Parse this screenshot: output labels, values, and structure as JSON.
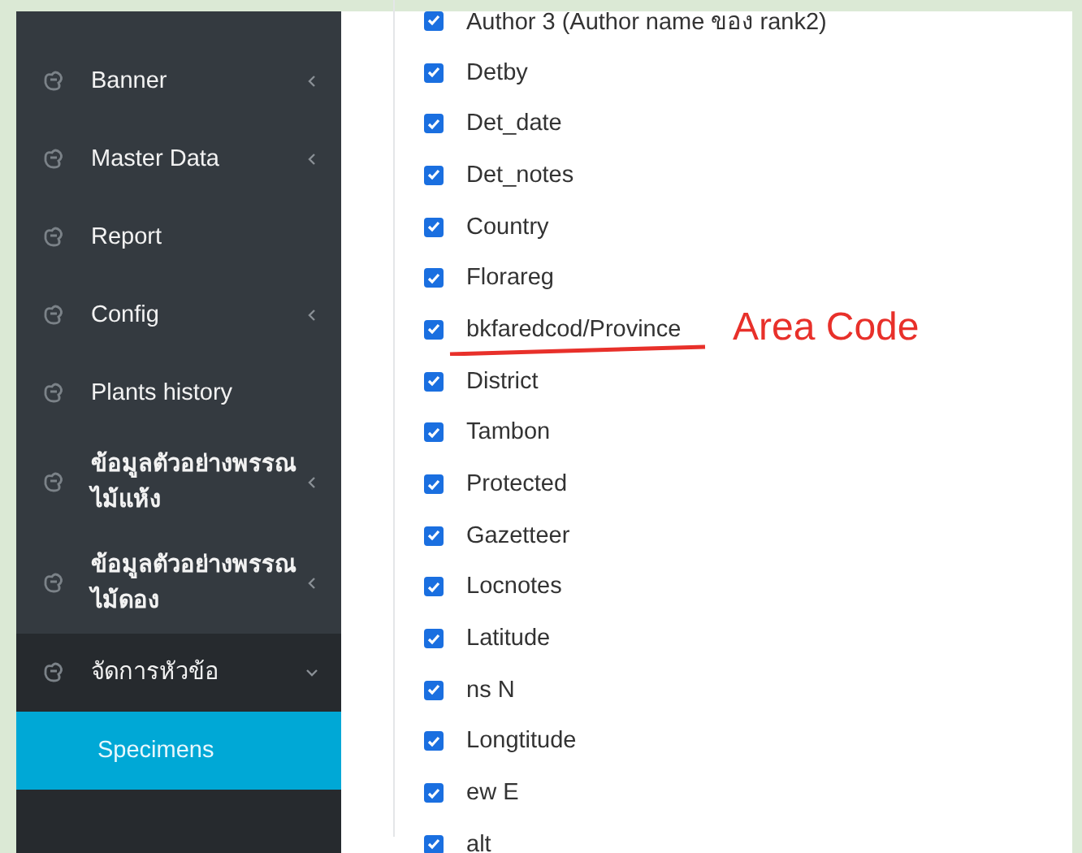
{
  "sidebar": {
    "items": [
      {
        "label": "Banner",
        "has_submenu": true,
        "expanded": false
      },
      {
        "label": "Master Data",
        "has_submenu": true,
        "expanded": false
      },
      {
        "label": "Report",
        "has_submenu": false,
        "expanded": false
      },
      {
        "label": "Config",
        "has_submenu": true,
        "expanded": false
      },
      {
        "label": "Plants history",
        "has_submenu": false,
        "expanded": false
      },
      {
        "label": "ข้อมูลตัวอย่างพรรณไม้แห้ง",
        "has_submenu": true,
        "expanded": false
      },
      {
        "label": "ข้อมูลตัวอย่างพรรณไม้ดอง",
        "has_submenu": true,
        "expanded": false
      },
      {
        "label": "จัดการหัวข้อ",
        "has_submenu": true,
        "expanded": true,
        "children": [
          {
            "label": "Specimens",
            "selected": true
          }
        ]
      }
    ]
  },
  "fields": [
    {
      "label": "Author 3 (Author name ของ rank2)",
      "checked": true
    },
    {
      "label": "Detby",
      "checked": true
    },
    {
      "label": "Det_date",
      "checked": true
    },
    {
      "label": "Det_notes",
      "checked": true
    },
    {
      "label": "Country",
      "checked": true
    },
    {
      "label": "Florareg",
      "checked": true
    },
    {
      "label": "bkfaredcod/Province",
      "checked": true,
      "annotation": "Area Code"
    },
    {
      "label": "District",
      "checked": true
    },
    {
      "label": "Tambon",
      "checked": true
    },
    {
      "label": "Protected",
      "checked": true
    },
    {
      "label": "Gazetteer",
      "checked": true
    },
    {
      "label": "Locnotes",
      "checked": true
    },
    {
      "label": "Latitude",
      "checked": true
    },
    {
      "label": "ns N",
      "checked": true
    },
    {
      "label": "Longtitude",
      "checked": true
    },
    {
      "label": "ew E",
      "checked": true
    },
    {
      "label": "alt",
      "checked": true
    }
  ]
}
